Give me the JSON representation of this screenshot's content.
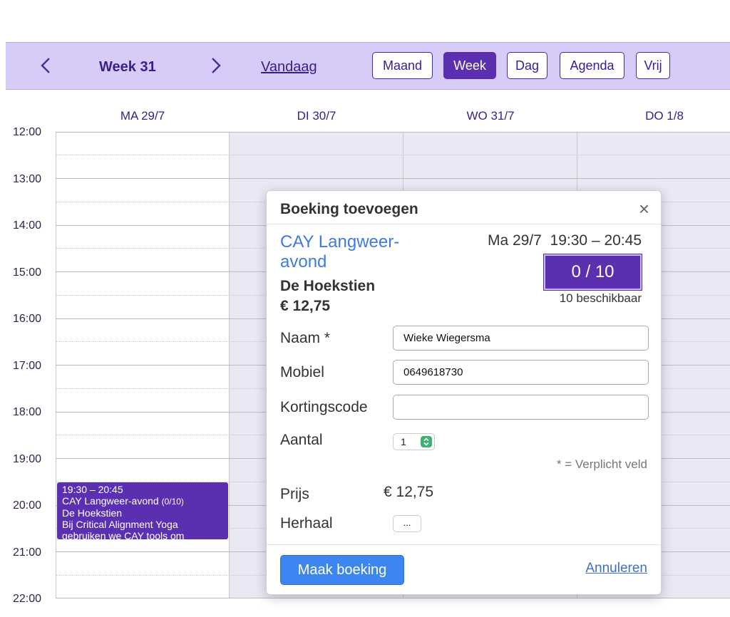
{
  "toolbar": {
    "week_title": "Week 31",
    "today_label": "Vandaag",
    "views": [
      "Maand",
      "Week",
      "Dag",
      "Agenda",
      "Vrij"
    ],
    "active_view": "Week",
    "accent_color": "#5a2fb0",
    "background_color": "#d6ccf7"
  },
  "calendar": {
    "days": [
      "MA 29/7",
      "DI 30/7",
      "WO 31/7",
      "DO 1/8"
    ],
    "times": [
      "12:00",
      "13:00",
      "14:00",
      "15:00",
      "16:00",
      "17:00",
      "18:00",
      "19:00",
      "20:00",
      "21:00",
      "22:00"
    ],
    "event": {
      "time": "19:30 – 20:45",
      "title": "CAY Langweer-avond",
      "count": "(0/10)",
      "location": "De Hoekstien",
      "description_line1": "Bij Critical Alignment Yoga",
      "description_line2": "gebruiken we CAY tools om"
    }
  },
  "dialog": {
    "title": "Boeking toevoegen",
    "close_icon": "×",
    "class_name": "CAY Langweer-avond",
    "location": "De Hoekstien",
    "price": "€ 12,75",
    "date": "Ma 29/7",
    "time": "19:30 – 20:45",
    "capacity": "0 / 10",
    "available": "10 beschikbaar",
    "fields": {
      "name_label": "Naam *",
      "name_value": "Wieke Wiegersma",
      "mobile_label": "Mobiel",
      "mobile_value": "0649618730",
      "discount_label": "Kortingscode",
      "discount_value": "",
      "quantity_label": "Aantal",
      "quantity_value": "1"
    },
    "required_note": "* = Verplicht veld",
    "price_label": "Prijs",
    "price_value": "€ 12,75",
    "repeat_label": "Herhaal",
    "repeat_button": "...",
    "submit_label": "Maak boeking",
    "cancel_label": "Annuleren"
  }
}
